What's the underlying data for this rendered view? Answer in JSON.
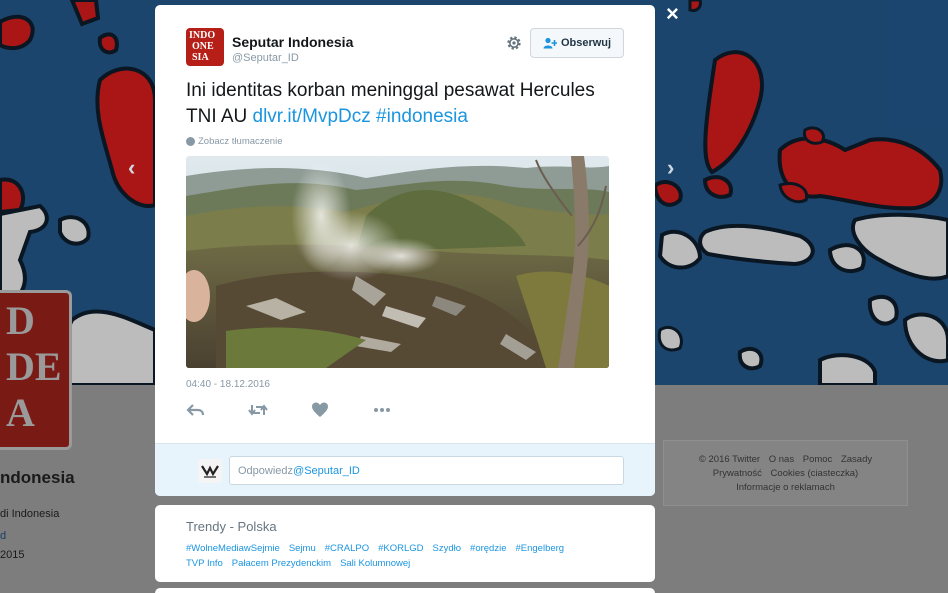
{
  "background": {
    "profile_name": "ndonesia",
    "profile_bio": "di Indonesia",
    "profile_link": "d",
    "profile_joined": "2015",
    "avatar_letters": [
      "D",
      "DE",
      "A"
    ],
    "footer_links": [
      "© 2016 Twitter",
      "O nas",
      "Pomoc",
      "Zasady",
      "Prywatność",
      "Cookies (ciasteczka)",
      "Informacje o reklamach"
    ],
    "header_colors": {
      "sea": "#1f4f7d",
      "highlight": "#d21a1a",
      "land": "#d8d8d8"
    }
  },
  "modal": {
    "close_icon": "×",
    "avatar_letters": [
      "INDO",
      "ONE",
      "SIA"
    ],
    "author_name": "Seputar Indonesia",
    "author_handle": "@Seputar_ID",
    "follow_label": "Obserwuj",
    "tweet_text": "Ini identitas korban meninggal pesawat Hercules TNI AU ",
    "tweet_link": "dlvr.it/MvpDcz",
    "tweet_hashtag": "#indonesia",
    "translate_label": "Zobacz tłumaczenie",
    "timestamp": "04:40 - 18.12.2016",
    "actions": [
      "reply-icon",
      "retweet-icon",
      "like-icon",
      "more-icon"
    ],
    "reply_placeholder": "Odpowiedz ",
    "reply_mention": "@Seputar_ID",
    "accent": "#1b95e0"
  },
  "trends": {
    "title": "Trendy - Polska",
    "items": [
      "#WolneMediawSejmie",
      "Sejmu",
      "#CRALPO",
      "#KORLGD",
      "Szydło",
      "#orędzie",
      "#Engelberg",
      "TVP Info",
      "Pałacem Prezydenckim",
      "Sali Kolumnowej"
    ]
  }
}
